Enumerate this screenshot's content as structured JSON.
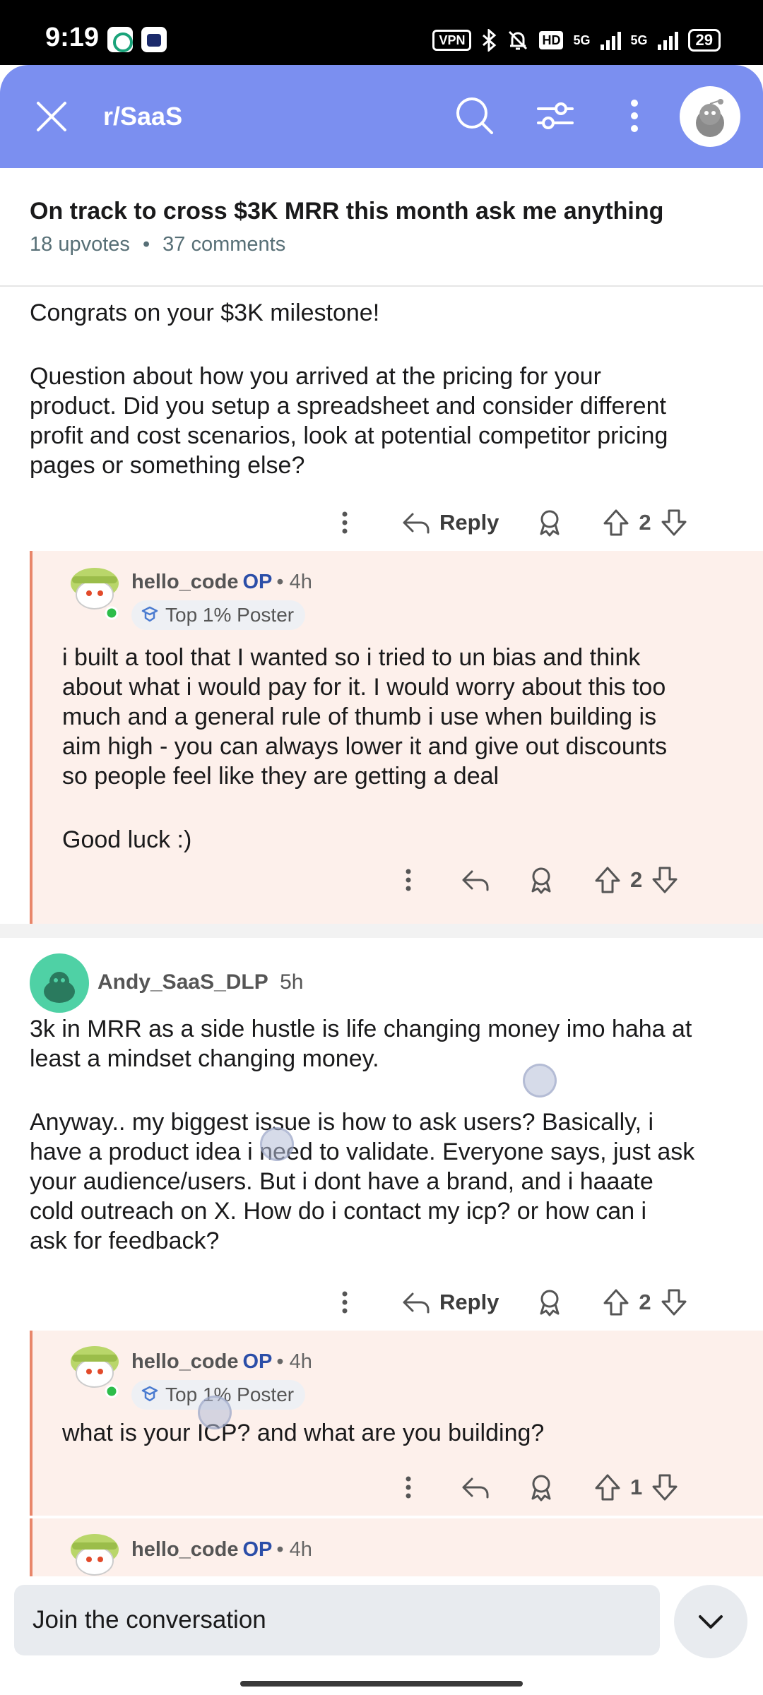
{
  "status_bar": {
    "time": "9:19",
    "vpn": "VPN",
    "hd": "HD",
    "network_1": "5G",
    "network_2": "5G",
    "battery": "29"
  },
  "app_bar": {
    "subreddit": "r/SaaS",
    "color": "#7b8ff0",
    "icons": [
      "close-icon",
      "search-icon",
      "filter-icon",
      "more-icon",
      "avatar"
    ]
  },
  "post": {
    "title": "On track to cross $3K MRR this month ask me anything",
    "upvotes": "18 upvotes",
    "separator": "•",
    "comments": "37 comments"
  },
  "comments": [
    {
      "lines": [
        "Congrats on your $3K milestone!",
        "",
        "Question about how you arrived at the pricing for your",
        "product. Did you setup a spreadsheet and consider different",
        "profit and cost scenarios, look at potential competitor pricing",
        "pages or something else?"
      ],
      "reply_label": "Reply",
      "score": "2",
      "reply": {
        "user": "hello_code",
        "op": "OP",
        "age": "• 4h",
        "flair": "Top 1% Poster",
        "lines": [
          "i built a tool that I wanted so i tried to un bias and think",
          "about what i would pay for it. I would worry about this too",
          "much and a general rule of thumb i use when building is",
          "aim high - you can always lower it and give out discounts",
          "so people feel like they are getting a deal",
          "",
          "Good luck :)"
        ],
        "score": "2"
      }
    },
    {
      "user": "Andy_SaaS_DLP",
      "age": "5h",
      "lines": [
        "3k in MRR as a side hustle is life changing money imo haha at",
        "least a mindset changing money.",
        "",
        "Anyway.. my biggest issue is how to ask users? Basically, i",
        "have a product idea i need to validate. Everyone says, just ask",
        "your audience/users. But i dont have a brand, and i haaate",
        "cold outreach on X. How do i contact my icp? or how can i",
        "ask for feedback?"
      ],
      "reply_label": "Reply",
      "score": "2",
      "replies": [
        {
          "user": "hello_code",
          "op": "OP",
          "age": "• 4h",
          "flair": "Top 1% Poster",
          "text": "what is your ICP? and what are you building?",
          "score": "1"
        },
        {
          "user": "hello_code",
          "op": "OP",
          "age": "• 4h"
        }
      ]
    }
  ],
  "composer": {
    "placeholder": "Join the conversation"
  }
}
